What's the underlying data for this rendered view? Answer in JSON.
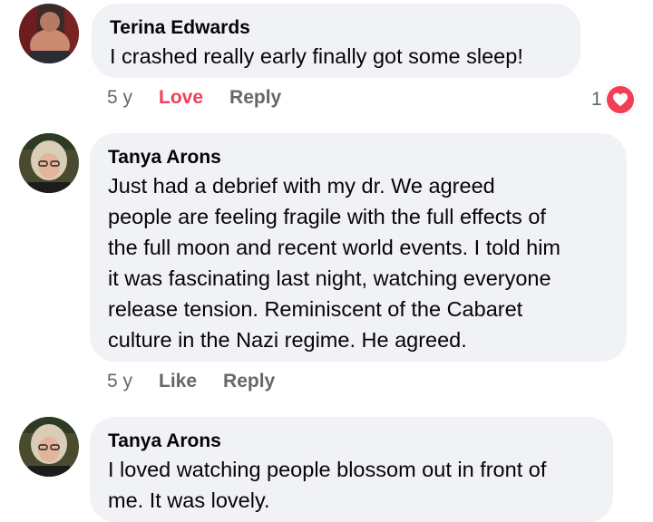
{
  "comments": [
    {
      "author": "Terina Edwards",
      "text": "I crashed really early finally got some sleep!",
      "time": "5 y",
      "reaction_action": "Love",
      "reply_label": "Reply",
      "reaction_count": "1",
      "reaction_icon": "heart-icon",
      "reaction_color": "#f33e58"
    },
    {
      "author": "Tanya Arons",
      "lines": [
        "Just had a debrief with my dr.  We agreed",
        "people are feeling fragile with the full effects of",
        "the full moon and recent world events. I told him",
        "it was fascinating last night, watching everyone",
        "release tension.  Reminiscent of the Cabaret",
        "culture in the Nazi regime.  He agreed."
      ],
      "time": "5 y",
      "reaction_action": "Like",
      "reply_label": "Reply"
    },
    {
      "author": "Tanya Arons",
      "lines": [
        "I loved watching people blossom out in front of",
        "me. It was lovely."
      ]
    }
  ],
  "colors": {
    "bubble": "#f0f2f5",
    "muted": "#65676b",
    "love": "#f33e58"
  }
}
